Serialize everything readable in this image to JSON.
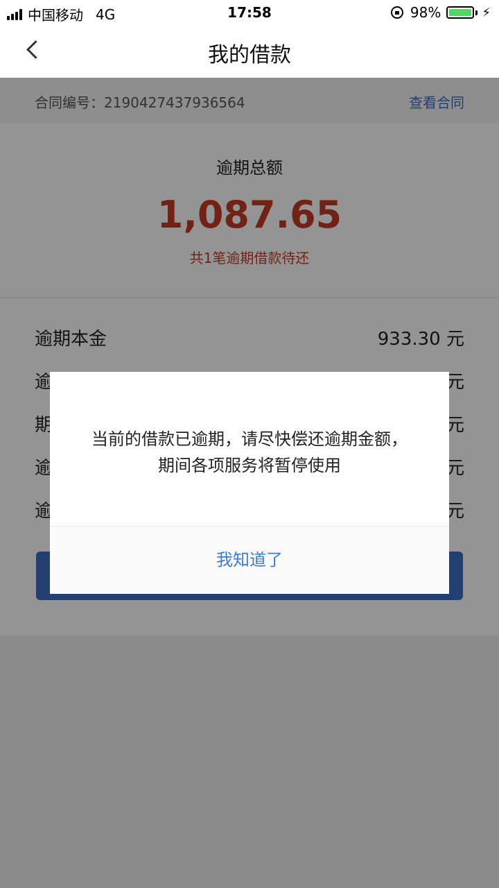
{
  "status_bar": {
    "carrier": "中国移动",
    "network": "4G",
    "time": "17:58",
    "battery_percent": "98%",
    "battery_level": 0.98,
    "icons": [
      "signal-icon",
      "orientation-lock-icon",
      "battery-icon",
      "charging-bolt-icon"
    ]
  },
  "nav": {
    "title": "我的借款",
    "back_icon": "back-chevron-icon"
  },
  "contract": {
    "label": "合同编号：2190427437936564",
    "link": "查看合同"
  },
  "summary": {
    "title": "逾期总额",
    "amount": "1,087.65",
    "subtitle": "共1笔逾期借款待还"
  },
  "details": {
    "rows": [
      {
        "label": "逾期本金",
        "value": "933.30 元"
      },
      {
        "label": "逾",
        "value": "元"
      },
      {
        "label": "期",
        "value": "元"
      },
      {
        "label": "逾",
        "value": "元"
      },
      {
        "label": "逾",
        "value": "元"
      }
    ]
  },
  "dialog": {
    "message": "当前的借款已逾期，请尽快偿还逾期金额，期间各项服务将暂停使用",
    "confirm_label": "我知道了"
  },
  "colors": {
    "accent_red": "#c53a25",
    "link_blue": "#3d6dc5",
    "button_blue": "#3d7bd8",
    "overlay": "rgba(0,0,0,0.42)"
  }
}
